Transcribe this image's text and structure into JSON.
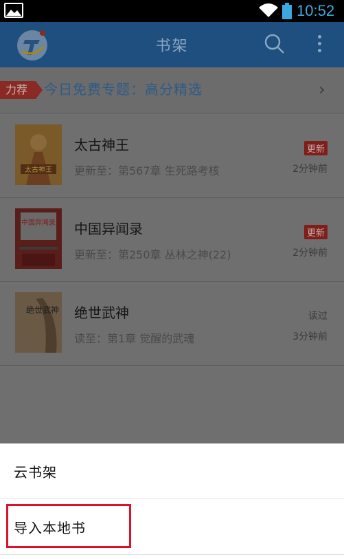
{
  "status_bar": {
    "time": "10:52",
    "gallery_icon": "image-icon",
    "wifi_icon": "wifi-icon",
    "battery_icon": "battery-icon"
  },
  "app_bar": {
    "title": "书架",
    "logo_icon": "app-logo-icon",
    "search_icon": "search-icon",
    "more_icon": "more-vert-icon"
  },
  "promo": {
    "badge": "力荐",
    "text": "今日免费专题：高分精选",
    "chevron_icon": "chevron-right-icon"
  },
  "books": [
    {
      "title": "太古神王",
      "subtitle": "更新至：第567章 生死路考核",
      "badge": "更新",
      "time": "2分钟前",
      "cover_text": "太古神王"
    },
    {
      "title": "中国异闻录",
      "subtitle": "更新至：第250章 丛林之神(22)",
      "badge": "更新",
      "time": "2分钟前",
      "cover_text": "中国异闻录"
    },
    {
      "title": "绝世武神",
      "subtitle": "读至：第1章 觉醒的武魂",
      "status": "读过",
      "time": "3分钟前",
      "cover_text": "绝世武神"
    }
  ],
  "sheet": {
    "items": [
      "云书架",
      "导入本地书"
    ]
  },
  "colors": {
    "app_bar": "#1e4f7f",
    "accent": "#3aa9e0",
    "badge_red": "#c0281e",
    "highlight": "#e0102a"
  }
}
